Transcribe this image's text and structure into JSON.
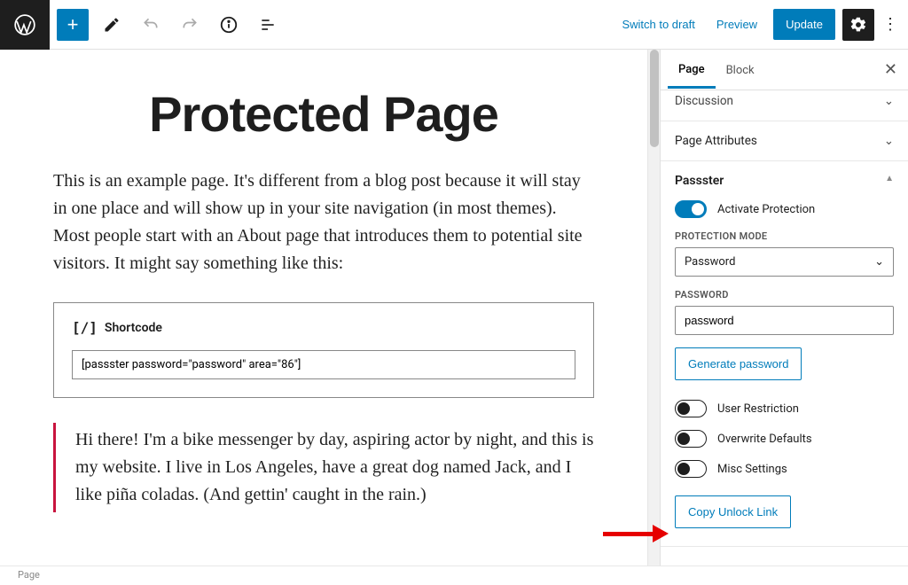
{
  "topbar": {
    "switch_draft": "Switch to draft",
    "preview": "Preview",
    "update": "Update"
  },
  "tabs": {
    "page": "Page",
    "block": "Block"
  },
  "panels": {
    "discussion": "Discussion",
    "page_attributes": "Page Attributes"
  },
  "passster": {
    "title": "Passster",
    "activate_label": "Activate Protection",
    "mode_label": "PROTECTION MODE",
    "mode_value": "Password",
    "password_label": "PASSWORD",
    "password_value": "password",
    "generate_btn": "Generate password",
    "user_restriction": "User Restriction",
    "overwrite_defaults": "Overwrite Defaults",
    "misc_settings": "Misc Settings",
    "copy_link": "Copy Unlock Link"
  },
  "content": {
    "title": "Protected Page",
    "para1": "This is an example page. It's different from a blog post because it will stay in one place and will show up in your site navigation (in most themes). Most people start with an About page that introduces them to potential site visitors. It might say something like this:",
    "shortcode_label": "Shortcode",
    "shortcode_value": "[passster password=\"password\" area=\"86\"]",
    "quote": "Hi there! I'm a bike messenger by day, aspiring actor by night, and this is my website. I live in Los Angeles, have a great dog named Jack, and I like piña coladas. (And gettin' caught in the rain.)"
  },
  "footer": {
    "breadcrumb": "Page"
  }
}
